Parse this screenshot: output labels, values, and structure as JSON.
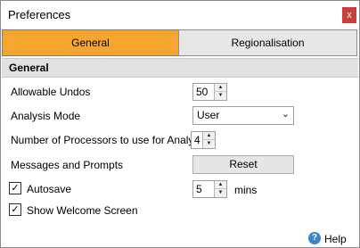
{
  "window": {
    "title": "Preferences",
    "close_glyph": "x"
  },
  "tabs": [
    {
      "label": "General",
      "active": true
    },
    {
      "label": "Regionalisation",
      "active": false
    }
  ],
  "section": {
    "header": "General"
  },
  "fields": {
    "allowable_undos": {
      "label": "Allowable Undos",
      "value": "50"
    },
    "analysis_mode": {
      "label": "Analysis Mode",
      "value": "User"
    },
    "processors": {
      "label": "Number of Processors to use for Analysis",
      "value": "4"
    },
    "messages": {
      "label": "Messages and Prompts",
      "button": "Reset"
    },
    "autosave": {
      "label": "Autosave",
      "checked": true,
      "value": "5",
      "unit": "mins"
    },
    "welcome": {
      "label": "Show Welcome Screen",
      "checked": true
    }
  },
  "help": {
    "label": "Help",
    "icon": "help-icon"
  },
  "colors": {
    "active_tab": "#f6a630",
    "close_button": "#c8403a",
    "section_header": "#e2e2e2"
  }
}
